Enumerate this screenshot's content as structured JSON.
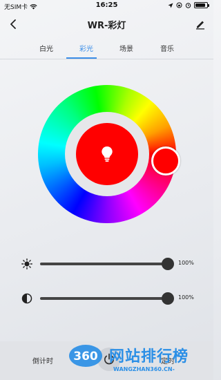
{
  "status_bar": {
    "carrier": "无SIM卡",
    "time": "16:25",
    "battery_level": 0.85
  },
  "header": {
    "title": "WR-彩灯",
    "back_icon": "chevron-left-icon",
    "edit_icon": "pencil-icon"
  },
  "tabs": [
    {
      "label": "白光",
      "active": false
    },
    {
      "label": "彩光",
      "active": true
    },
    {
      "label": "场景",
      "active": false
    },
    {
      "label": "音乐",
      "active": false
    }
  ],
  "color_picker": {
    "selected_color": "#ff0000",
    "center_icon": "bulb-icon"
  },
  "sliders": {
    "brightness": {
      "icon": "sun-icon",
      "value": 100,
      "label": "100%"
    },
    "saturation": {
      "icon": "contrast-icon",
      "value": 100,
      "label": "100%"
    }
  },
  "bottom_bar": {
    "countdown_label": "倒计时",
    "timer_label": "定时",
    "power_icon": "power-icon"
  },
  "watermark": {
    "badge_text": "360",
    "site_name": "网站排行榜",
    "url": "WANGZHAN360.CN-"
  },
  "colors": {
    "accent": "#3b8ee8",
    "slider": "#333333",
    "watermark": "#2b8fe6"
  }
}
